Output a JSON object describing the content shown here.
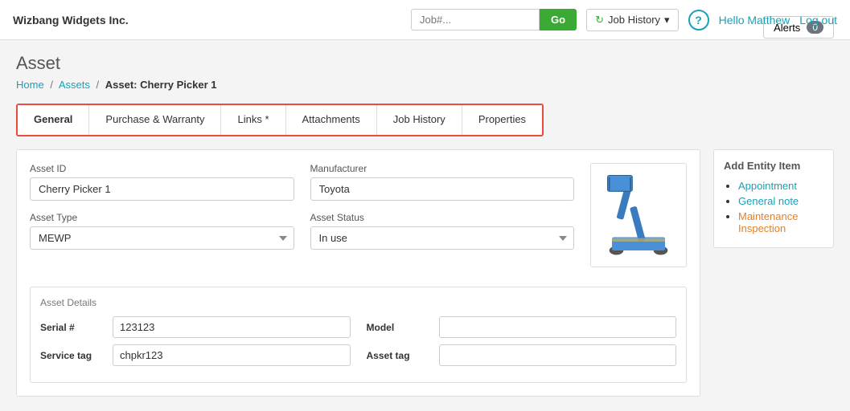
{
  "header": {
    "logo": "Wizbang Widgets Inc.",
    "search_placeholder": "Job#...",
    "go_button": "Go",
    "job_history_label": "Job History",
    "help_icon": "?",
    "user_greeting": "Hello Matthew",
    "logout_label": "Log out"
  },
  "page": {
    "title": "Asset",
    "breadcrumb": {
      "home": "Home",
      "assets": "Assets",
      "current": "Asset: Cherry Picker 1"
    },
    "alerts_label": "Alerts",
    "alerts_count": "0"
  },
  "tabs": [
    {
      "id": "general",
      "label": "General",
      "active": true
    },
    {
      "id": "purchase-warranty",
      "label": "Purchase & Warranty",
      "active": false
    },
    {
      "id": "links",
      "label": "Links *",
      "active": false
    },
    {
      "id": "attachments",
      "label": "Attachments",
      "active": false
    },
    {
      "id": "job-history",
      "label": "Job History",
      "active": false
    },
    {
      "id": "properties",
      "label": "Properties",
      "active": false
    }
  ],
  "form": {
    "asset_id_label": "Asset ID",
    "asset_id_value": "Cherry Picker 1",
    "manufacturer_label": "Manufacturer",
    "manufacturer_value": "Toyota",
    "asset_type_label": "Asset Type",
    "asset_type_value": "MEWP",
    "asset_status_label": "Asset Status",
    "asset_status_value": "In use",
    "asset_details_title": "Asset Details",
    "serial_label": "Serial #",
    "serial_value": "123123",
    "model_label": "Model",
    "model_value": "",
    "service_tag_label": "Service tag",
    "service_tag_value": "chpkr123",
    "asset_tag_label": "Asset tag",
    "asset_tag_value": ""
  },
  "add_entity": {
    "title": "Add Entity Item",
    "items": [
      {
        "label": "Appointment",
        "class": "appointment"
      },
      {
        "label": "General note",
        "class": "general-note"
      },
      {
        "label": "Maintenance Inspection",
        "class": "maintenance"
      }
    ]
  }
}
